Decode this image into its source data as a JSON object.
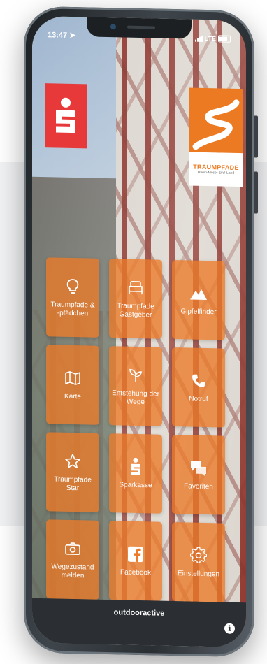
{
  "status_bar": {
    "time": "13:47",
    "network": "LTE"
  },
  "header": {
    "sparkasse_logo_icon": "sparkasse-s-logo",
    "traumpfade_logo": {
      "title": "TRAUMPFADE",
      "subtitle": "Rhein-Mosel-Eifel-Land"
    }
  },
  "menu": {
    "tiles": [
      {
        "label": "Traumpfade & -pfädchen",
        "icon": "lightbulb-icon"
      },
      {
        "label": "Traumpfade Gastgeber",
        "icon": "bed-icon"
      },
      {
        "label": "Gipfelfinder",
        "icon": "mountain-icon"
      },
      {
        "label": "Karte",
        "icon": "map-icon"
      },
      {
        "label": "Entstehung der Wege",
        "icon": "sprout-icon"
      },
      {
        "label": "Notruf",
        "icon": "phone-icon"
      },
      {
        "label": "Traumpfade Star",
        "icon": "star-icon"
      },
      {
        "label": "Sparkasse",
        "icon": "sparkasse-icon"
      },
      {
        "label": "Favoriten",
        "icon": "chat-icon"
      },
      {
        "label": "Wegezustand melden",
        "icon": "camera-icon"
      },
      {
        "label": "Facebook",
        "icon": "facebook-icon"
      },
      {
        "label": "Einstellungen",
        "icon": "gear-icon"
      }
    ]
  },
  "footer": {
    "brand": "outdooractive",
    "info_label": "i"
  },
  "colors": {
    "tile": "#ec7a28",
    "sparkasse_red": "#e8393a",
    "traumpfade_orange": "#ec7a22",
    "footer": "#2b2f33"
  }
}
